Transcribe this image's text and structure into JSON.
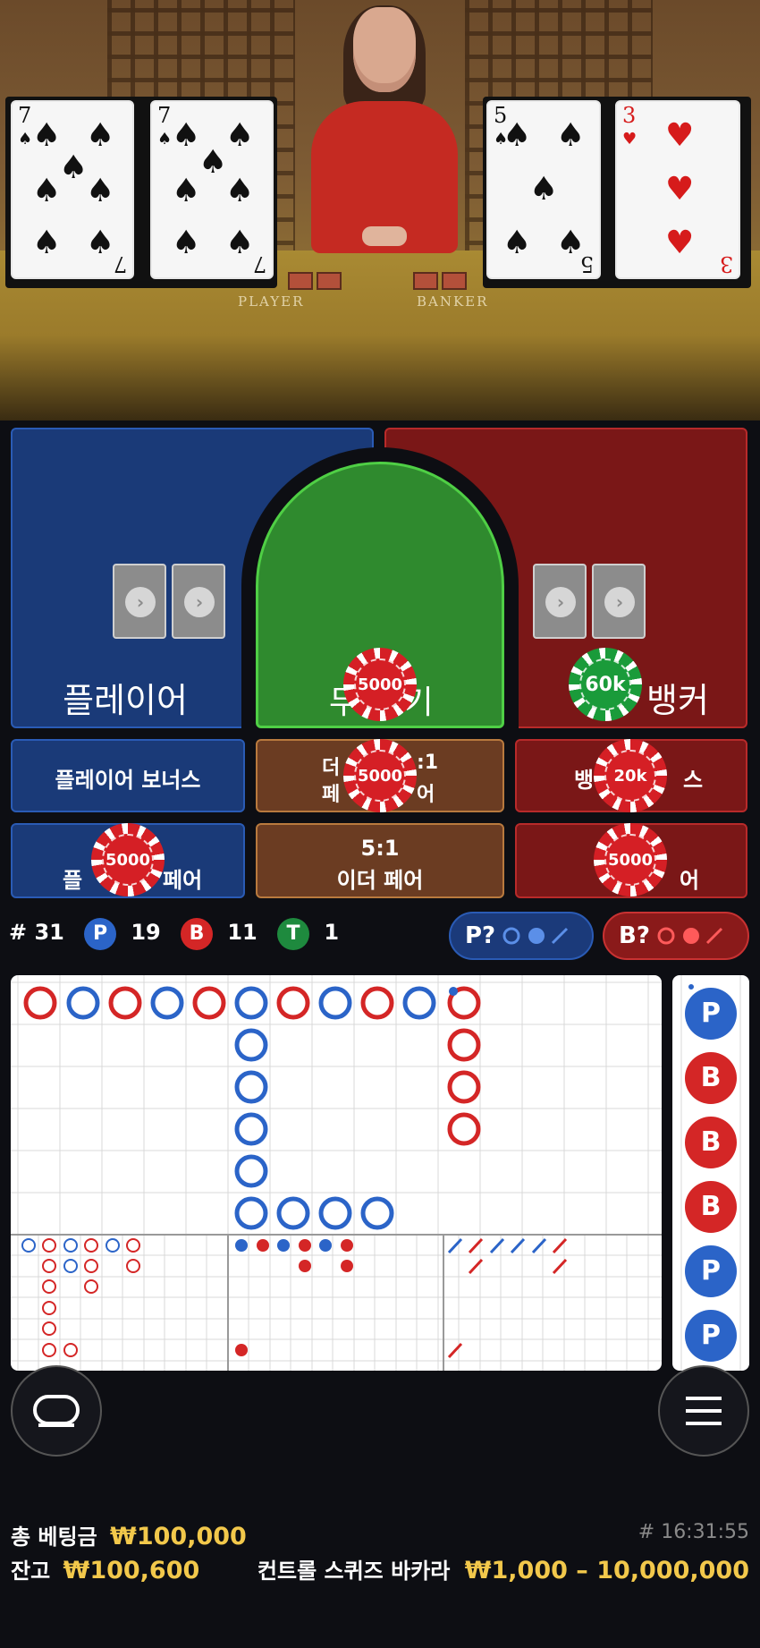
{
  "video": {
    "table_labels": {
      "player": "PLAYER",
      "banker": "BANKER"
    },
    "player_cards": [
      {
        "rank": "7",
        "suit": "♠",
        "color": "black"
      },
      {
        "rank": "7",
        "suit": "♠",
        "color": "black"
      }
    ],
    "banker_cards": [
      {
        "rank": "5",
        "suit": "♠",
        "color": "black"
      },
      {
        "rank": "3",
        "suit": "♥",
        "color": "red"
      }
    ]
  },
  "bets": {
    "player": "플레이어",
    "tie": "무승부",
    "tie_visible": [
      "무",
      "기"
    ],
    "banker": "뱅커",
    "player_bonus": "플레이어 보너스",
    "either_pair_top": [
      "더",
      ":1",
      "페",
      "어"
    ],
    "banker_bonus_visible": [
      "뱅",
      "스"
    ],
    "player_pair_visible": [
      "플",
      "페어"
    ],
    "either_pair_bottom": [
      "5:1",
      "이더 페어"
    ],
    "banker_pair_visible": [
      "",
      "어"
    ],
    "chips": {
      "tie": "5000",
      "banker": "60k",
      "either_pair_top": "5000",
      "banker_bonus": "20k",
      "player_pair": "5000",
      "banker_pair": "5000"
    }
  },
  "stats": {
    "round_label": "# 31",
    "player_letter": "P",
    "player_count": "19",
    "banker_letter": "B",
    "banker_count": "11",
    "tie_letter": "T",
    "tie_count": "1",
    "player_ask": "P?",
    "banker_ask": "B?"
  },
  "side_road": [
    "P",
    "B",
    "B",
    "B",
    "P",
    "P"
  ],
  "footer": {
    "total_bet_label": "총 베팅금",
    "total_bet_value": "₩100,000",
    "balance_label": "잔고",
    "balance_value": "₩100,600",
    "game_id": "# 16:31:55",
    "game_name": "컨트롤 스퀴즈 바카라",
    "limits": "₩1,000 – 10,000,000"
  },
  "colors": {
    "player": "#2b64c8",
    "banker": "#d42626",
    "tie": "#1e8a3e",
    "gold": "#f2c84b"
  },
  "icons": [
    "arrow-right-icon",
    "chat-icon",
    "menu-icon"
  ]
}
